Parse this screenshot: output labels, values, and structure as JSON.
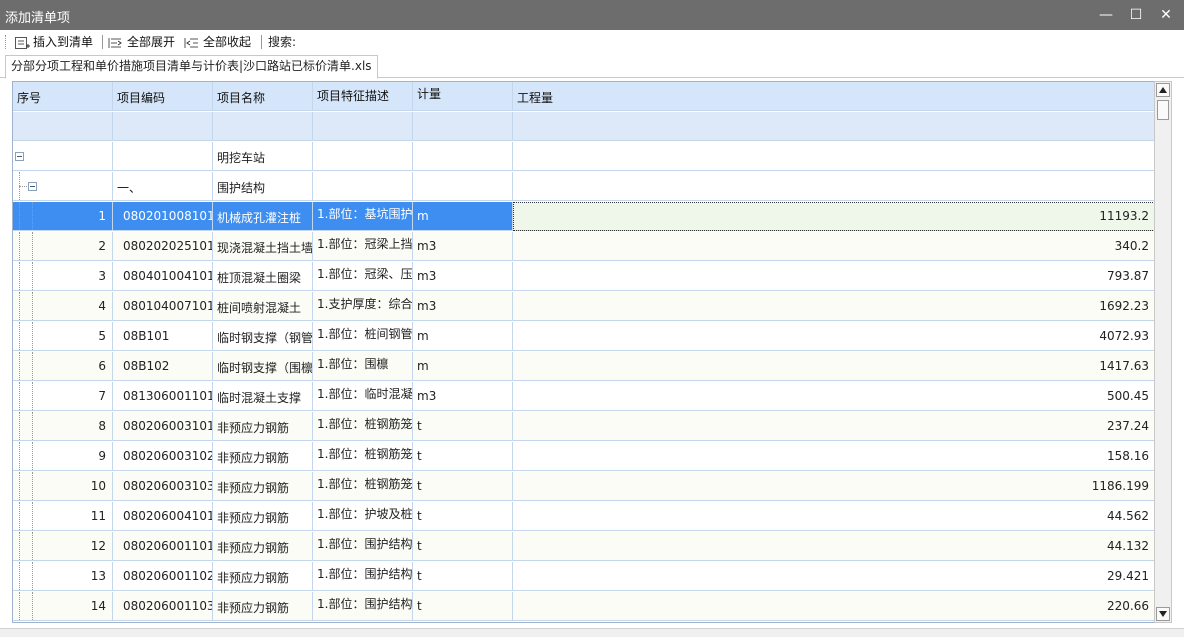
{
  "window": {
    "title": "添加清单项",
    "minimize_glyph": "—",
    "maximize_glyph": "☐",
    "close_glyph": "✕"
  },
  "toolbar": {
    "insert_label": "插入到清单",
    "expand_all_label": "全部展开",
    "collapse_all_label": "全部收起",
    "search_label": "搜索:"
  },
  "tab": {
    "label": "分部分项工程和单价措施项目清单与计价表|沙口路站已标价清单.xls"
  },
  "grid": {
    "headers": [
      "序号",
      "项目编码",
      "项目名称",
      "项目特征描述",
      "计量",
      "工程量"
    ],
    "groups": [
      {
        "code": "",
        "name": "明挖车站"
      },
      {
        "code": "一、",
        "name": "围护结构"
      }
    ],
    "rows": [
      {
        "no": "1",
        "code": "080201008101",
        "name": "机械成孔灌注桩",
        "desc": "1.部位：基坑围护",
        "unit": "m",
        "qty": "11193.2"
      },
      {
        "no": "2",
        "code": "080202025101",
        "name": "现浇混凝土挡土墙",
        "desc": "1.部位：冠梁上挡",
        "unit": "m3",
        "qty": "340.2"
      },
      {
        "no": "3",
        "code": "080401004101",
        "name": "桩顶混凝土圈梁",
        "desc": "1.部位：冠梁、压",
        "unit": "m3",
        "qty": "793.87"
      },
      {
        "no": "4",
        "code": "080104007101",
        "name": "桩间喷射混凝土",
        "desc": "1.支护厚度：综合",
        "unit": "m3",
        "qty": "1692.23"
      },
      {
        "no": "5",
        "code": "08B101",
        "name": "临时钢支撑（钢管",
        "desc": "1.部位：桩间钢管",
        "unit": "m",
        "qty": "4072.93"
      },
      {
        "no": "6",
        "code": "08B102",
        "name": "临时钢支撑（围檩",
        "desc": "1.部位：围檩",
        "unit": "m",
        "qty": "1417.63"
      },
      {
        "no": "7",
        "code": "081306001101",
        "name": "临时混凝土支撑",
        "desc": "1.部位：临时混凝",
        "unit": "m3",
        "qty": "500.45"
      },
      {
        "no": "8",
        "code": "080206003101",
        "name": "非预应力钢筋",
        "desc": "1.部位：桩钢筋笼",
        "unit": "t",
        "qty": "237.24"
      },
      {
        "no": "9",
        "code": "080206003102",
        "name": "非预应力钢筋",
        "desc": "1.部位：桩钢筋笼",
        "unit": "t",
        "qty": "158.16"
      },
      {
        "no": "10",
        "code": "080206003103",
        "name": "非预应力钢筋",
        "desc": "1.部位：桩钢筋笼",
        "unit": "t",
        "qty": "1186.199"
      },
      {
        "no": "11",
        "code": "080206004101",
        "name": "非预应力钢筋",
        "desc": "1.部位：护坡及桩",
        "unit": "t",
        "qty": "44.562"
      },
      {
        "no": "12",
        "code": "080206001101",
        "name": "非预应力钢筋",
        "desc": "1.部位：围护结构",
        "unit": "t",
        "qty": "44.132"
      },
      {
        "no": "13",
        "code": "080206001102",
        "name": "非预应力钢筋",
        "desc": "1.部位：围护结构",
        "unit": "t",
        "qty": "29.421"
      },
      {
        "no": "14",
        "code": "080206001103",
        "name": "非预应力钢筋",
        "desc": "1.部位：围护结构",
        "unit": "t",
        "qty": "220.66"
      }
    ]
  },
  "colors": {
    "titlebar": "#6d6d6d",
    "header_bg": "#d6e6fa",
    "selected_row": "#3d8ef0",
    "selected_qty_bg": "#eef7ea"
  }
}
